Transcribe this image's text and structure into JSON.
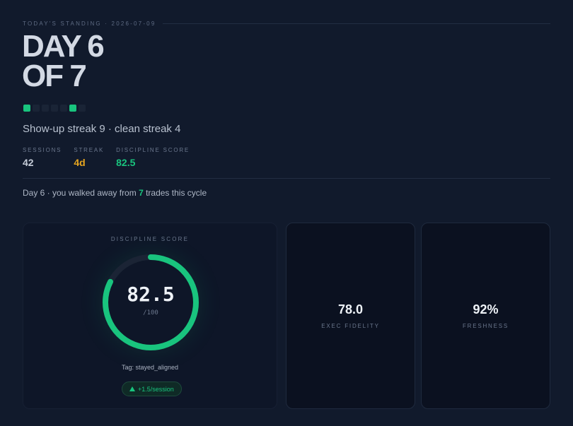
{
  "header": {
    "eyebrow": "TODAY'S STANDING · 2026-07-09",
    "headline_line1": "DAY 6",
    "headline_line2": "OF 7",
    "day_dots": [
      true,
      false,
      false,
      false,
      false,
      true,
      false
    ],
    "streak_text": "Show-up streak 9 · clean streak 4"
  },
  "stats": {
    "sessions_label": "SESSIONS",
    "sessions_value": "42",
    "streak_label": "STREAK",
    "streak_value": "4d",
    "discipline_label": "DISCIPLINE SCORE",
    "discipline_value": "82.5"
  },
  "message": {
    "prefix": "Day 6 · you walked away from ",
    "count": "7",
    "suffix": " trades this cycle"
  },
  "score_card": {
    "title": "DISCIPLINE SCORE",
    "score": "82.5",
    "score_fraction": 0.825,
    "denominator": "/100",
    "tag": "Tag: stayed_aligned",
    "delta": "+1.5/session"
  },
  "exec_card": {
    "value": "78.0",
    "label": "EXEC FIDELITY"
  },
  "fresh_card": {
    "value": "92%",
    "label": "FRESHNESS"
  },
  "colors": {
    "accent_green": "#19c47e",
    "accent_amber": "#e6a520",
    "background": "#111a2c"
  },
  "icons": {
    "delta": "triangle-up-icon"
  }
}
